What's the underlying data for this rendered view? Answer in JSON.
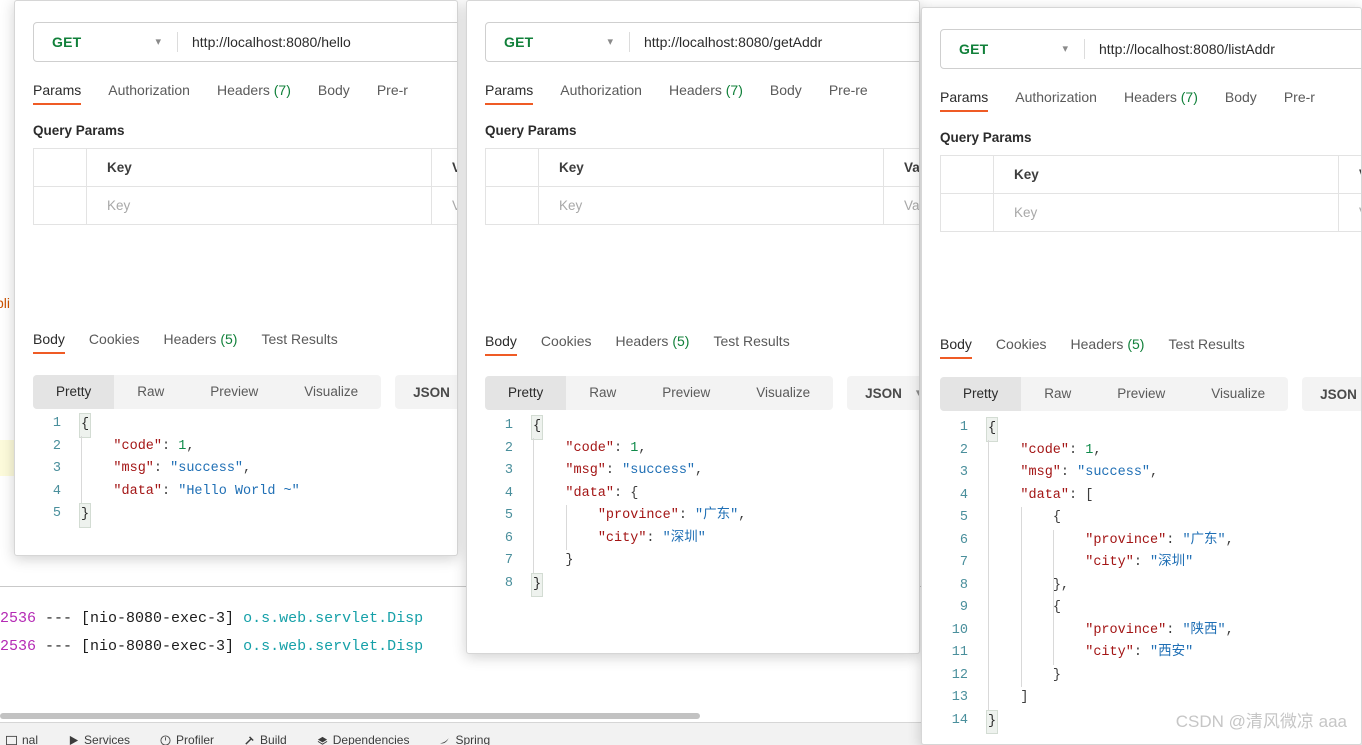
{
  "ide": {
    "fragment_text": "pli",
    "console_lines": [
      {
        "pid": "2536",
        "dashes": "--- [nio-8080-exec-3]",
        "logger": "o.s.web.servlet.Disp"
      },
      {
        "pid": "2536",
        "dashes": "--- [nio-8080-exec-3]",
        "logger": "o.s.web.servlet.Disp"
      }
    ],
    "bottom_bar": [
      {
        "label": "nal",
        "icon": "terminal-icon"
      },
      {
        "label": "Services",
        "icon": "services-play-icon"
      },
      {
        "label": "Profiler",
        "icon": "profiler-icon"
      },
      {
        "label": "Build",
        "icon": "build-hammer-icon"
      },
      {
        "label": "Dependencies",
        "icon": "dependencies-icon"
      },
      {
        "label": "Spring",
        "icon": "spring-leaf-icon"
      }
    ]
  },
  "colors": {
    "accent": "#ef5b25",
    "method_green": "#11803a",
    "json_key": "#a31515",
    "json_string": "#1f6fb5",
    "json_number": "#0f8a4a",
    "gutter": "#4a8f9c",
    "log_pid": "#b52ab5",
    "log_logger": "#15a0a8"
  },
  "request_tabs": [
    {
      "label": "Params"
    },
    {
      "label": "Authorization"
    },
    {
      "label": "Headers",
      "count": "(7)"
    },
    {
      "label": "Body"
    }
  ],
  "response_tabs": [
    {
      "label": "Body"
    },
    {
      "label": "Cookies"
    },
    {
      "label": "Headers",
      "count": "(5)"
    },
    {
      "label": "Test Results"
    }
  ],
  "format_tabs": [
    "Pretty",
    "Raw",
    "Preview",
    "Visualize"
  ],
  "common": {
    "method": "GET",
    "query_params_title": "Query Params",
    "key_header": "Key",
    "value_header_full": "Value",
    "key_placeholder": "Key",
    "value_placeholder": "Value",
    "json_label": "JSON",
    "pre_request_partial_1": "Pre-r",
    "pre_request_partial_2": "Pre-re",
    "pre_request_partial_3": "Pre-r",
    "value_partial_short": "Va",
    "value_partial_long": "Valu"
  },
  "windows": [
    {
      "id": "hello",
      "url": "http://localhost:8080/hello",
      "value_header": "Va",
      "value_placeholder_shown": "Va",
      "pre_request_label": "Pre-r",
      "code_lines": [
        {
          "n": "1",
          "indent": 0,
          "tokens": [
            {
              "t": "{",
              "c": "fold"
            }
          ]
        },
        {
          "n": "2",
          "indent": 1,
          "tokens": [
            {
              "t": "\"code\"",
              "c": "k-key"
            },
            {
              "t": ": ",
              "c": "k-pun"
            },
            {
              "t": "1",
              "c": "k-num"
            },
            {
              "t": ",",
              "c": "k-pun"
            }
          ]
        },
        {
          "n": "3",
          "indent": 1,
          "tokens": [
            {
              "t": "\"msg\"",
              "c": "k-key"
            },
            {
              "t": ": ",
              "c": "k-pun"
            },
            {
              "t": "\"success\"",
              "c": "k-str"
            },
            {
              "t": ",",
              "c": "k-pun"
            }
          ]
        },
        {
          "n": "4",
          "indent": 1,
          "tokens": [
            {
              "t": "\"data\"",
              "c": "k-key"
            },
            {
              "t": ": ",
              "c": "k-pun"
            },
            {
              "t": "\"Hello World ~\"",
              "c": "k-str"
            }
          ]
        },
        {
          "n": "5",
          "indent": 0,
          "tokens": [
            {
              "t": "}",
              "c": "fold"
            }
          ]
        }
      ]
    },
    {
      "id": "getAddr",
      "url": "http://localhost:8080/getAddr",
      "value_header": "Valu",
      "value_placeholder_shown": "Valu",
      "pre_request_label": "Pre-re",
      "code_lines": [
        {
          "n": "1",
          "indent": 0,
          "tokens": [
            {
              "t": "{",
              "c": "fold"
            }
          ]
        },
        {
          "n": "2",
          "indent": 1,
          "tokens": [
            {
              "t": "\"code\"",
              "c": "k-key"
            },
            {
              "t": ": ",
              "c": "k-pun"
            },
            {
              "t": "1",
              "c": "k-num"
            },
            {
              "t": ",",
              "c": "k-pun"
            }
          ]
        },
        {
          "n": "3",
          "indent": 1,
          "tokens": [
            {
              "t": "\"msg\"",
              "c": "k-key"
            },
            {
              "t": ": ",
              "c": "k-pun"
            },
            {
              "t": "\"success\"",
              "c": "k-str"
            },
            {
              "t": ",",
              "c": "k-pun"
            }
          ]
        },
        {
          "n": "4",
          "indent": 1,
          "tokens": [
            {
              "t": "\"data\"",
              "c": "k-key"
            },
            {
              "t": ": ",
              "c": "k-pun"
            },
            {
              "t": "{",
              "c": "k-pun"
            }
          ]
        },
        {
          "n": "5",
          "indent": 2,
          "tokens": [
            {
              "t": "\"province\"",
              "c": "k-key"
            },
            {
              "t": ": ",
              "c": "k-pun"
            },
            {
              "t": "\"广东\"",
              "c": "k-str"
            },
            {
              "t": ",",
              "c": "k-pun"
            }
          ]
        },
        {
          "n": "6",
          "indent": 2,
          "tokens": [
            {
              "t": "\"city\"",
              "c": "k-key"
            },
            {
              "t": ": ",
              "c": "k-pun"
            },
            {
              "t": "\"深圳\"",
              "c": "k-str"
            }
          ]
        },
        {
          "n": "7",
          "indent": 1,
          "tokens": [
            {
              "t": "}",
              "c": "k-pun"
            }
          ]
        },
        {
          "n": "8",
          "indent": 0,
          "tokens": [
            {
              "t": "}",
              "c": "fold"
            }
          ]
        }
      ]
    },
    {
      "id": "listAddr",
      "url": "http://localhost:8080/listAddr",
      "value_header": "Va",
      "value_placeholder_shown": "Va",
      "pre_request_label": "Pre-r",
      "code_lines": [
        {
          "n": "1",
          "indent": 0,
          "tokens": [
            {
              "t": "{",
              "c": "fold"
            }
          ]
        },
        {
          "n": "2",
          "indent": 1,
          "tokens": [
            {
              "t": "\"code\"",
              "c": "k-key"
            },
            {
              "t": ": ",
              "c": "k-pun"
            },
            {
              "t": "1",
              "c": "k-num"
            },
            {
              "t": ",",
              "c": "k-pun"
            }
          ]
        },
        {
          "n": "3",
          "indent": 1,
          "tokens": [
            {
              "t": "\"msg\"",
              "c": "k-key"
            },
            {
              "t": ": ",
              "c": "k-pun"
            },
            {
              "t": "\"success\"",
              "c": "k-str"
            },
            {
              "t": ",",
              "c": "k-pun"
            }
          ]
        },
        {
          "n": "4",
          "indent": 1,
          "tokens": [
            {
              "t": "\"data\"",
              "c": "k-key"
            },
            {
              "t": ": ",
              "c": "k-pun"
            },
            {
              "t": "[",
              "c": "k-pun"
            }
          ]
        },
        {
          "n": "5",
          "indent": 2,
          "tokens": [
            {
              "t": "{",
              "c": "k-pun"
            }
          ]
        },
        {
          "n": "6",
          "indent": 3,
          "tokens": [
            {
              "t": "\"province\"",
              "c": "k-key"
            },
            {
              "t": ": ",
              "c": "k-pun"
            },
            {
              "t": "\"广东\"",
              "c": "k-str"
            },
            {
              "t": ",",
              "c": "k-pun"
            }
          ]
        },
        {
          "n": "7",
          "indent": 3,
          "tokens": [
            {
              "t": "\"city\"",
              "c": "k-key"
            },
            {
              "t": ": ",
              "c": "k-pun"
            },
            {
              "t": "\"深圳\"",
              "c": "k-str"
            }
          ]
        },
        {
          "n": "8",
          "indent": 2,
          "tokens": [
            {
              "t": "},",
              "c": "k-pun"
            }
          ]
        },
        {
          "n": "9",
          "indent": 2,
          "tokens": [
            {
              "t": "{",
              "c": "k-pun"
            }
          ]
        },
        {
          "n": "10",
          "indent": 3,
          "tokens": [
            {
              "t": "\"province\"",
              "c": "k-key"
            },
            {
              "t": ": ",
              "c": "k-pun"
            },
            {
              "t": "\"陕西\"",
              "c": "k-str"
            },
            {
              "t": ",",
              "c": "k-pun"
            }
          ]
        },
        {
          "n": "11",
          "indent": 3,
          "tokens": [
            {
              "t": "\"city\"",
              "c": "k-key"
            },
            {
              "t": ": ",
              "c": "k-pun"
            },
            {
              "t": "\"西安\"",
              "c": "k-str"
            }
          ]
        },
        {
          "n": "12",
          "indent": 2,
          "tokens": [
            {
              "t": "}",
              "c": "k-pun"
            }
          ]
        },
        {
          "n": "13",
          "indent": 1,
          "tokens": [
            {
              "t": "]",
              "c": "k-pun"
            }
          ]
        },
        {
          "n": "14",
          "indent": 0,
          "tokens": [
            {
              "t": "}",
              "c": "fold"
            }
          ]
        }
      ]
    }
  ],
  "watermark": "CSDN @清风微凉 aaa"
}
